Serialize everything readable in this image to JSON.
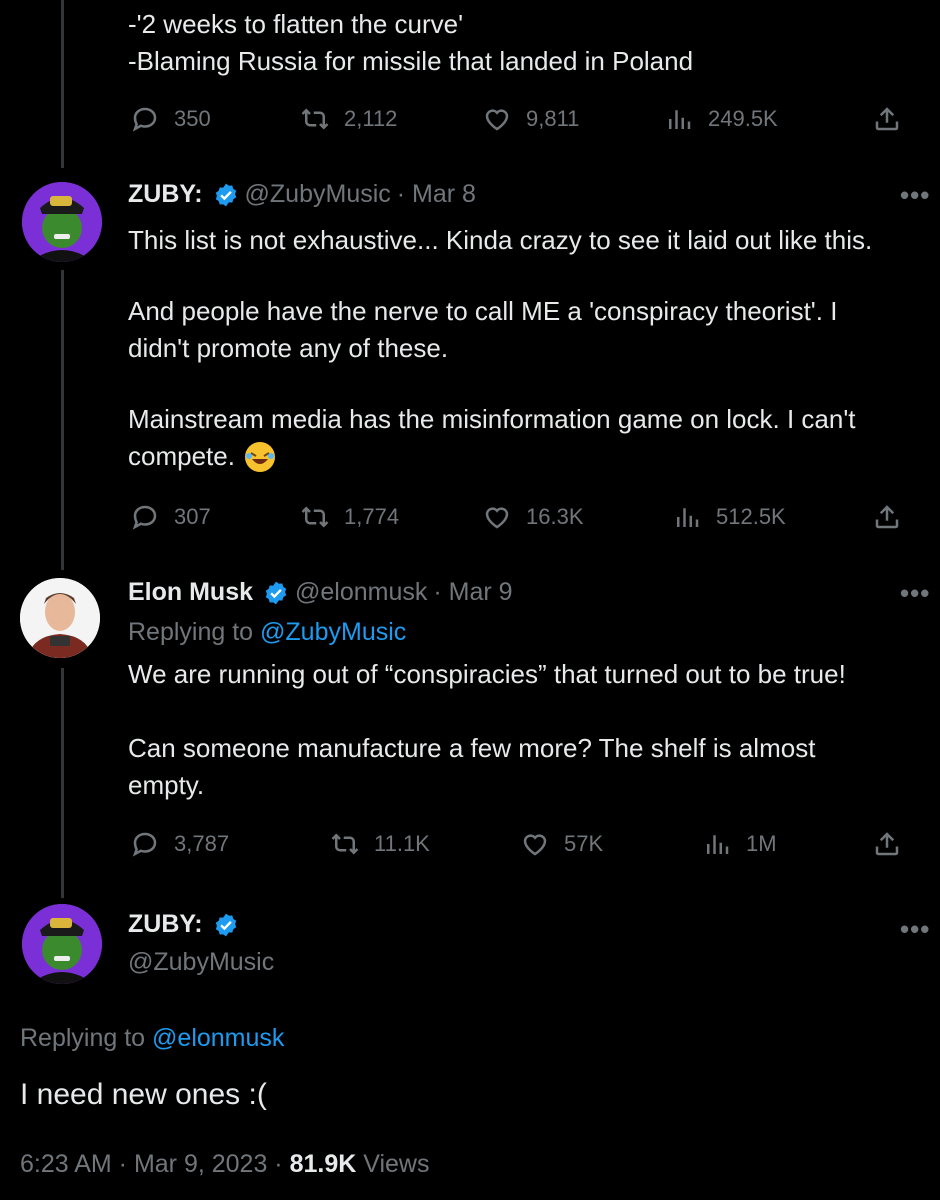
{
  "top_tweet": {
    "lines": [
      "-'2 weeks to flatten the curve'",
      "-Blaming Russia for missile that landed in Poland"
    ],
    "replies": "350",
    "retweets": "2,112",
    "likes": "9,811",
    "views": "249.5K"
  },
  "zuby_tweet": {
    "name": "ZUBY:",
    "handle": "@ZubyMusic",
    "date": "· Mar 8",
    "p1": "This list is not exhaustive... Kinda crazy to see it laid out like this.",
    "p2a": "And people have the nerve to call ME a 'conspiracy theorist'. I",
    "p2b": "didn't promote any of these.",
    "p3a": "Mainstream media has the misinformation game on lock. I can't",
    "p3b": "compete.",
    "replies": "307",
    "retweets": "1,774",
    "likes": "16.3K",
    "views": "512.5K"
  },
  "elon_tweet": {
    "name": "Elon Musk",
    "handle": "@elonmusk",
    "date": "· Mar 9",
    "replying_label": "Replying to",
    "replying_to": "@ZubyMusic",
    "p1": "We are running out of “conspiracies” that turned out to be true!",
    "p2a": "Can someone manufacture a few more? The shelf is almost",
    "p2b": "empty.",
    "replies": "3,787",
    "retweets": "11.1K",
    "likes": "57K",
    "views": "1M"
  },
  "main_tweet": {
    "name": "ZUBY:",
    "handle": "@ZubyMusic",
    "replying_label": "Replying to",
    "replying_to": "@elonmusk",
    "text": "I need new ones :(",
    "time": "6:23 AM · Mar 9, 2023 ·",
    "views_count": "81.9K",
    "views_label": "Views"
  },
  "more_label": "•••",
  "colors": {
    "background": "#000000",
    "text": "#e7e9ea",
    "muted": "#71767b",
    "link": "#1d9bf0",
    "verified": "#1d9bf0"
  }
}
